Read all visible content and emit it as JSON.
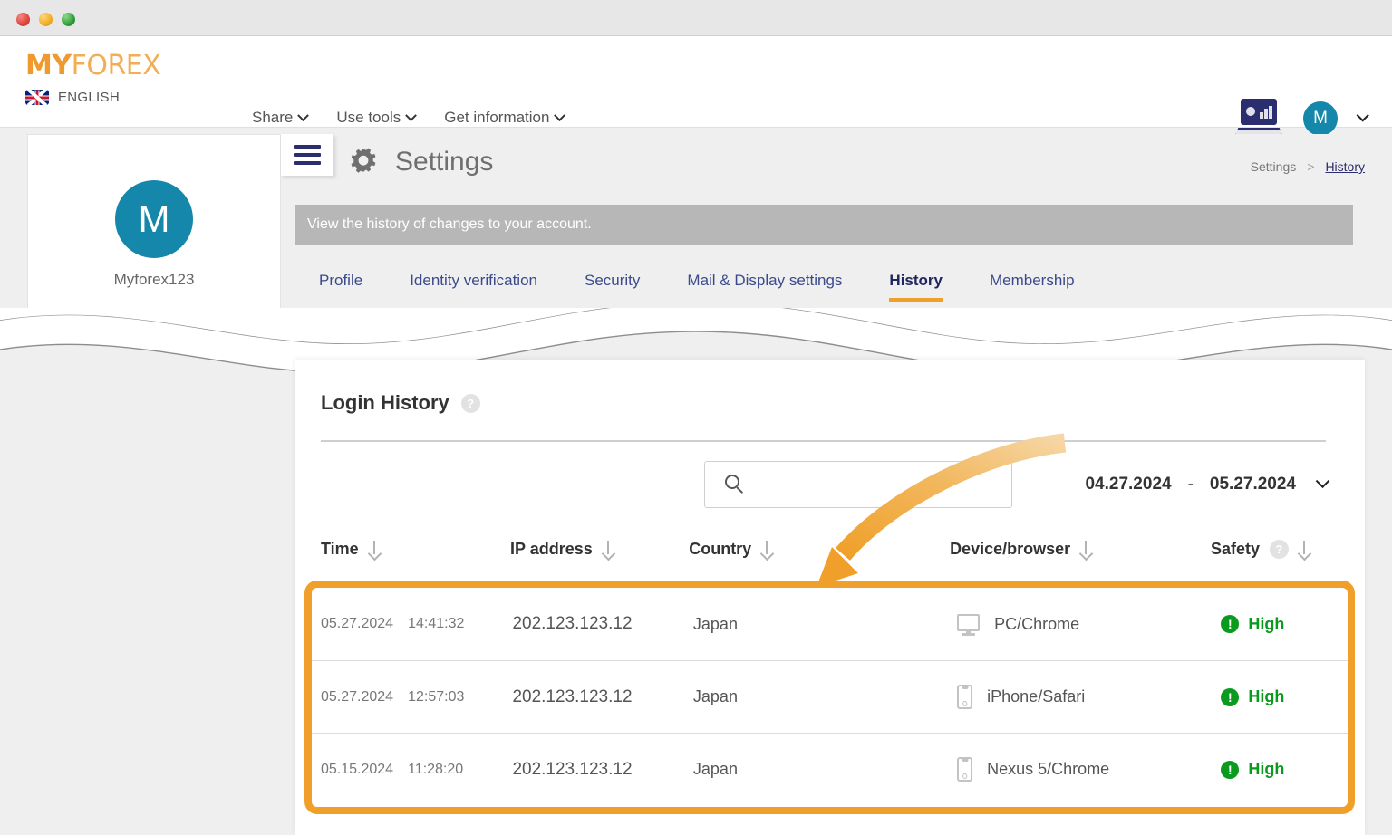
{
  "window": {
    "controls": [
      "close",
      "minimize",
      "maximize"
    ]
  },
  "header": {
    "logo_my": "MY",
    "logo_forex": "FOREX",
    "language": "ENGLISH",
    "nav": [
      {
        "label": "Share",
        "icon": "chevron-down-icon"
      },
      {
        "label": "Use tools",
        "icon": "chevron-down-icon"
      },
      {
        "label": "Get information",
        "icon": "chevron-down-icon"
      }
    ],
    "platform_icon": "laptop-chart-icon",
    "avatar_initial": "M",
    "account_chevron": "chevron-down-icon"
  },
  "sidebar": {
    "avatar_initial": "M",
    "camera_icon": "camera-icon",
    "username": "Myforex123"
  },
  "settings": {
    "menu_icon": "hamburger-menu-icon",
    "gear_icon": "gear-icon",
    "title": "Settings",
    "breadcrumb": {
      "root": "Settings",
      "separator": ">",
      "current": "History"
    },
    "notice": "View the history of changes to your account.",
    "tabs": [
      {
        "label": "Profile",
        "active": false
      },
      {
        "label": "Identity verification",
        "active": false
      },
      {
        "label": "Security",
        "active": false
      },
      {
        "label": "Mail & Display settings",
        "active": false
      },
      {
        "label": "History",
        "active": true
      },
      {
        "label": "Membership",
        "active": false
      }
    ]
  },
  "login_history": {
    "title": "Login History",
    "help_icon": "question-mark-icon",
    "search": {
      "placeholder": "",
      "value": "",
      "icon": "search-icon"
    },
    "date_range": {
      "from": "04.27.2024",
      "separator": "-",
      "to": "05.27.2024",
      "chevron": "chevron-down-icon"
    },
    "columns": [
      {
        "label": "Time",
        "sort_icon": "sort-down-icon"
      },
      {
        "label": "IP address",
        "sort_icon": "sort-down-icon"
      },
      {
        "label": "Country",
        "sort_icon": "sort-down-icon"
      },
      {
        "label": "Device/browser",
        "sort_icon": "sort-down-icon"
      },
      {
        "label": "Safety",
        "help_icon": "question-mark-icon",
        "sort_icon": "sort-down-icon"
      }
    ],
    "rows": [
      {
        "date": "05.27.2024",
        "time": "14:41:32",
        "ip": "202.123.123.12",
        "country": "Japan",
        "device_icon": "monitor-icon",
        "device": "PC/Chrome",
        "safety": "High",
        "safety_icon": "exclamation-circle-icon"
      },
      {
        "date": "05.27.2024",
        "time": "12:57:03",
        "ip": "202.123.123.12",
        "country": "Japan",
        "device_icon": "smartphone-icon",
        "device": "iPhone/Safari",
        "safety": "High",
        "safety_icon": "exclamation-circle-icon"
      },
      {
        "date": "05.15.2024",
        "time": "11:28:20",
        "ip": "202.123.123.12",
        "country": "Japan",
        "device_icon": "smartphone-icon",
        "device": "Nexus 5/Chrome",
        "safety": "High",
        "safety_icon": "exclamation-circle-icon"
      }
    ],
    "annotation": {
      "arrow_icon": "curved-arrow-icon",
      "highlight_color": "#f0a02a"
    }
  },
  "colors": {
    "brand_orange": "#f0a23c",
    "highlight_orange": "#f0a02a",
    "navy": "#2a2d6e",
    "teal": "#1487ab",
    "safety_green": "#0a9a1e",
    "notice_gray": "#b7b7b7"
  }
}
